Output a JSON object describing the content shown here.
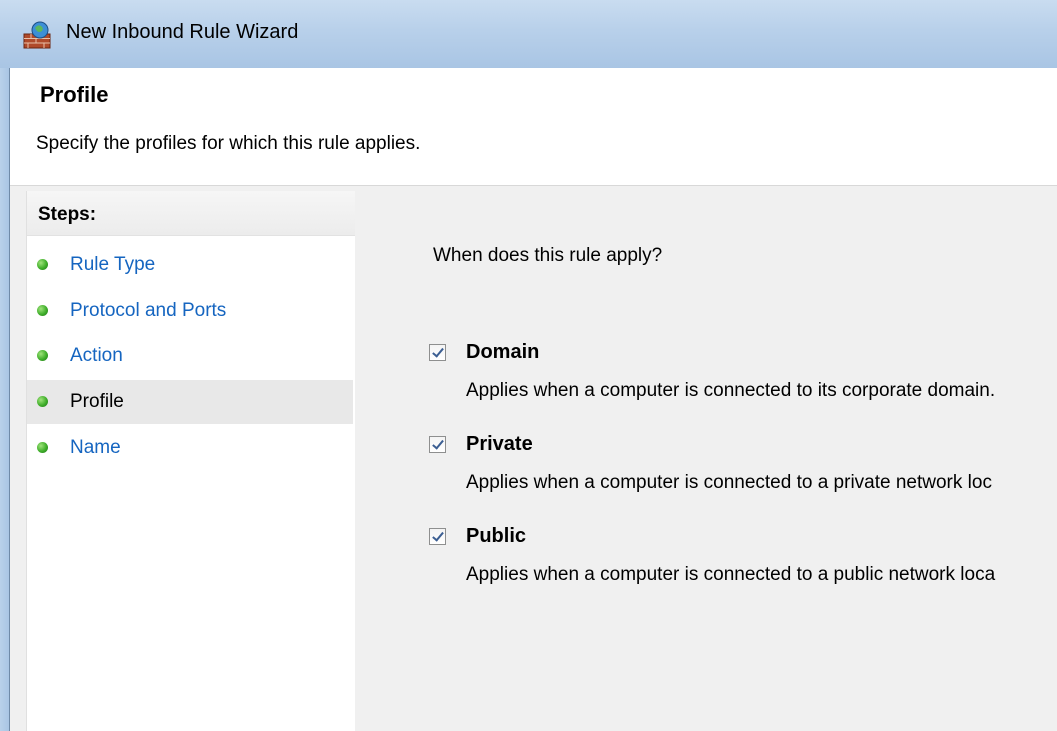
{
  "window": {
    "title": "New Inbound Rule Wizard",
    "icon": "firewall-globe-icon"
  },
  "header": {
    "title": "Profile",
    "description": "Specify the profiles for which this rule applies."
  },
  "steps": {
    "heading": "Steps:",
    "items": [
      {
        "label": "Rule Type",
        "current": false
      },
      {
        "label": "Protocol and Ports",
        "current": false
      },
      {
        "label": "Action",
        "current": false
      },
      {
        "label": "Profile",
        "current": true
      },
      {
        "label": "Name",
        "current": false
      }
    ]
  },
  "content": {
    "question": "When does this rule apply?",
    "options": [
      {
        "label": "Domain",
        "checked": true,
        "description": "Applies when a computer is connected to its corporate domain."
      },
      {
        "label": "Private",
        "checked": true,
        "description": "Applies when a computer is connected to a private network loc"
      },
      {
        "label": "Public",
        "checked": true,
        "description": "Applies when a computer is connected to a public network loca"
      }
    ]
  },
  "colors": {
    "link": "#1565c0",
    "step_dot": "#3fae2a",
    "titlebar": "#b8d0ea"
  }
}
